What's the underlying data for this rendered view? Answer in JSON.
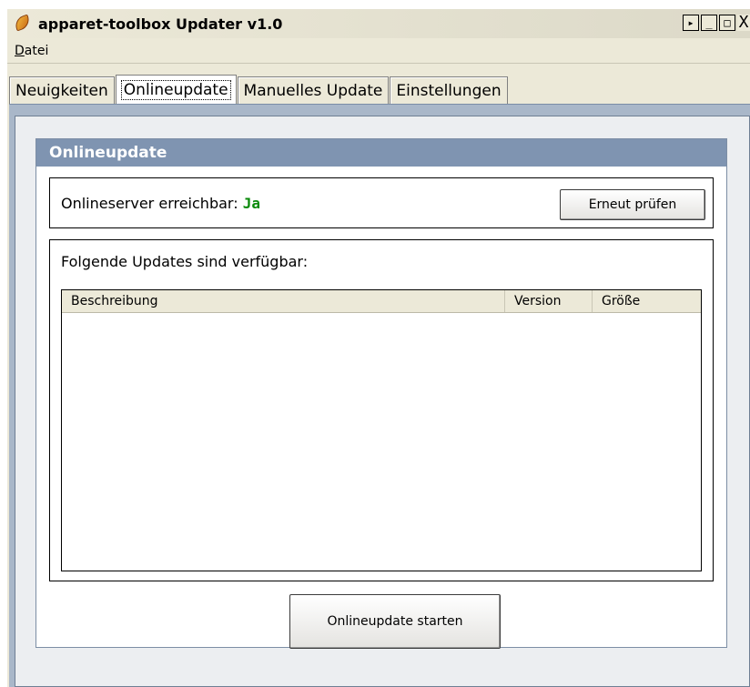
{
  "window": {
    "title": "apparet-toolbox Updater v1.0",
    "controls": {
      "help": "▸",
      "minimize": "_",
      "maximize": "□",
      "close": "X"
    }
  },
  "menubar": {
    "file_label_ul": "D",
    "file_label_rest": "atei"
  },
  "tabs": [
    {
      "label": "Neuigkeiten"
    },
    {
      "label": "Onlineupdate"
    },
    {
      "label": "Manuelles Update"
    },
    {
      "label": "Einstellungen"
    }
  ],
  "active_tab": "Onlineupdate",
  "panel": {
    "title": "Onlineupdate",
    "server": {
      "label": "Onlineserver erreichbar:",
      "status": "Ja",
      "recheck_button": "Erneut prüfen"
    },
    "updates": {
      "label": "Folgende Updates sind verfügbar:",
      "columns": [
        "Beschreibung",
        "Version",
        "Größe"
      ],
      "rows": []
    },
    "start_button": "Onlineupdate starten"
  },
  "colors": {
    "panel_header": "#7f94b1",
    "status_ok": "#0a8a0a",
    "tabpage_frame": "#a9b7c9"
  }
}
